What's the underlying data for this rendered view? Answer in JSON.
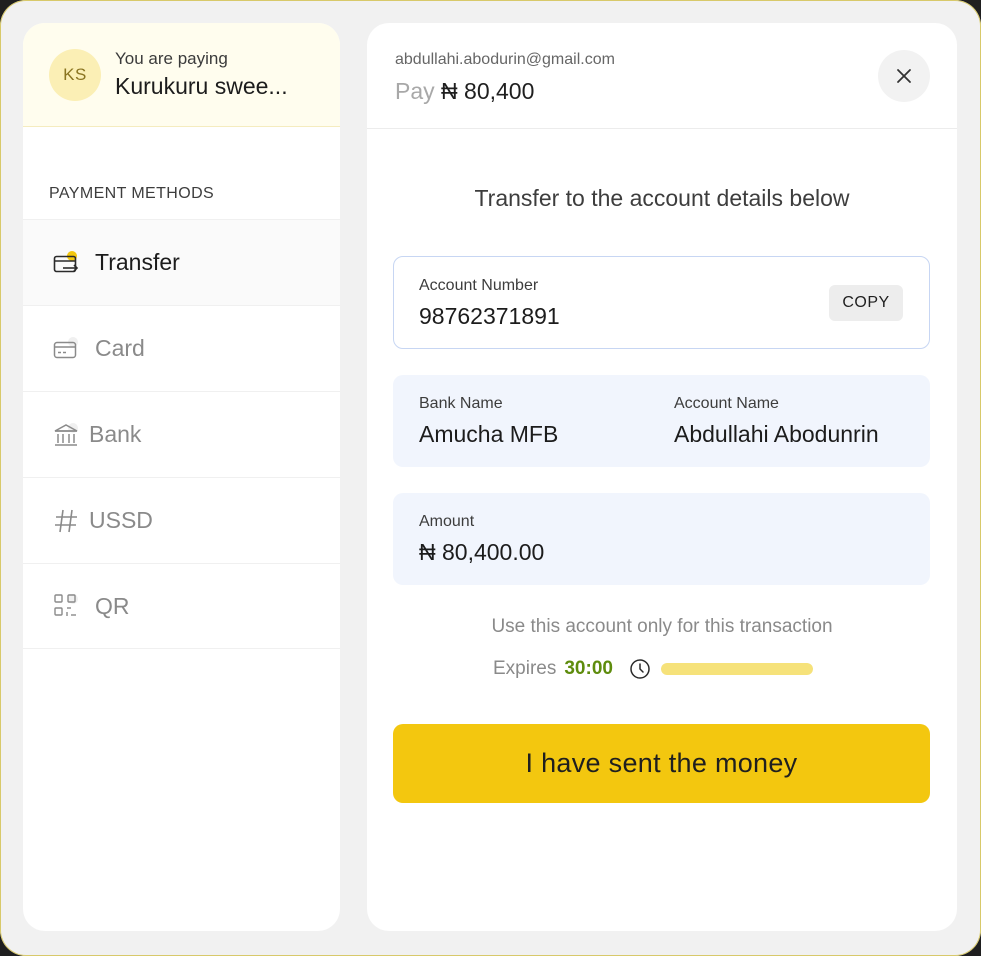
{
  "merchant": {
    "initials": "KS",
    "paying_label": "You are paying",
    "name": "Kurukuru swee..."
  },
  "payment_methods": {
    "heading": "PAYMENT METHODS",
    "items": [
      {
        "label": "Transfer",
        "icon": "transfer-icon",
        "active": true
      },
      {
        "label": "Card",
        "icon": "card-icon",
        "active": false
      },
      {
        "label": "Bank",
        "icon": "bank-icon",
        "active": false
      },
      {
        "label": "USSD",
        "icon": "hash-icon",
        "active": false
      },
      {
        "label": "QR",
        "icon": "qr-icon",
        "active": false
      }
    ]
  },
  "header": {
    "email": "abdullahi.abodurin@gmail.com",
    "pay_word": "Pay",
    "pay_amount": "₦ 80,400"
  },
  "transfer": {
    "instruction": "Transfer to the account details below",
    "account_number_label": "Account Number",
    "account_number": "98762371891",
    "copy_label": "COPY",
    "bank_name_label": "Bank Name",
    "bank_name": "Amucha MFB",
    "account_name_label": "Account Name",
    "account_name": "Abdullahi Abodunrin",
    "amount_label": "Amount",
    "amount": "₦ 80,400.00",
    "note": "Use this account only for this transaction",
    "expires_label": "Expires",
    "timer": "30:00",
    "progress_fraction": 1.0,
    "cta_label": "I have sent the money"
  },
  "colors": {
    "accent": "#f3c70f",
    "timer": "#5e8c0d",
    "info_bg": "#f1f5fd"
  }
}
